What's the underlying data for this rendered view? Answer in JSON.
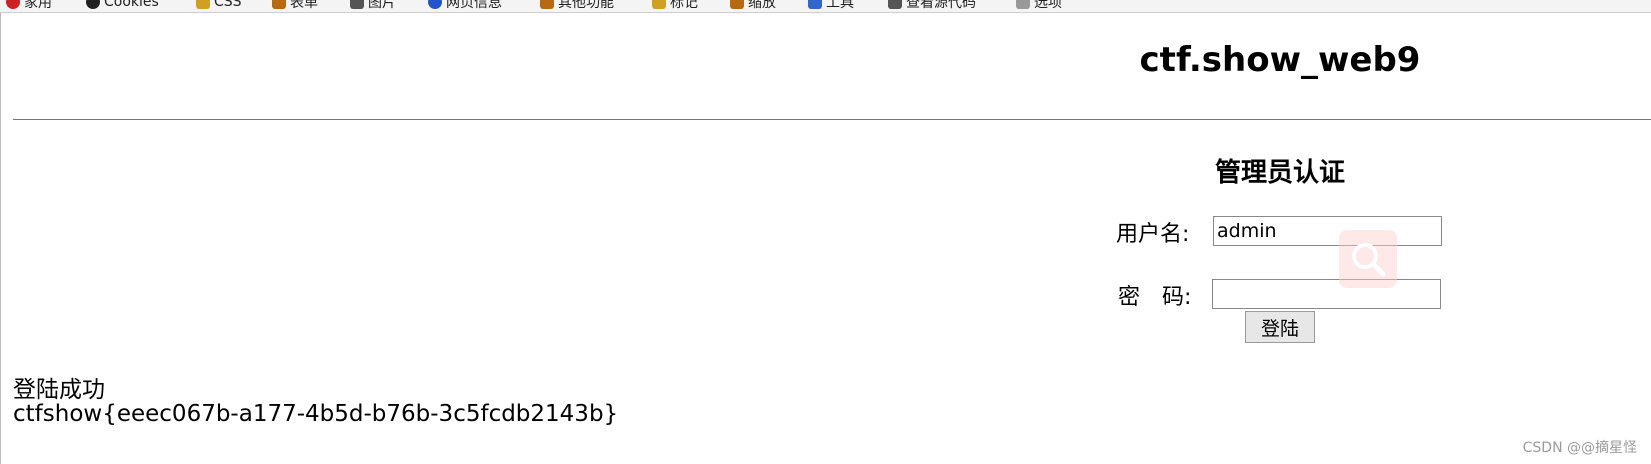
{
  "bookmarks": [
    {
      "label": "家用",
      "color": "#cc2222"
    },
    {
      "label": "Cookies",
      "color": "#222222"
    },
    {
      "label": "CSS",
      "color": "#d0a020"
    },
    {
      "label": "表单",
      "color": "#b86a10"
    },
    {
      "label": "图片",
      "color": "#555555"
    },
    {
      "label": "网页信息",
      "color": "#2255cc"
    },
    {
      "label": "其他功能",
      "color": "#b86a10"
    },
    {
      "label": "标记",
      "color": "#d0a020"
    },
    {
      "label": "缩放",
      "color": "#b86a10"
    },
    {
      "label": "工具",
      "color": "#3366cc"
    },
    {
      "label": "查看源代码",
      "color": "#555555"
    },
    {
      "label": "选项",
      "color": "#999999"
    }
  ],
  "page": {
    "title": "ctf.show_web9"
  },
  "form": {
    "title": "管理员认证",
    "username_label": "用户名:",
    "username_value": "admin",
    "password_label_1": "密",
    "password_label_2": "码:",
    "password_value": "",
    "login_button": "登陆"
  },
  "result": {
    "status": "登陆成功",
    "flag": "ctfshow{eeec067b-a177-4b5d-b76b-3c5fcdb2143b}"
  },
  "watermark": "CSDN @@摘星怪",
  "icons": {
    "overlay": "search-icon"
  }
}
